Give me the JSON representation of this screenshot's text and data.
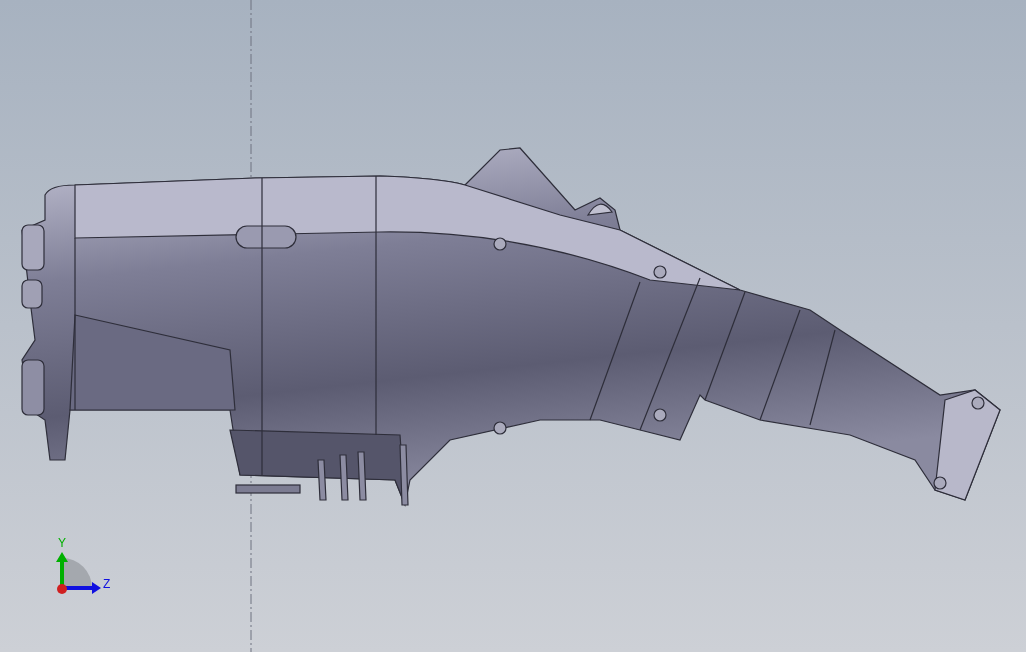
{
  "viewport": {
    "triad": {
      "axes": [
        {
          "label": "Y",
          "kind": "vertical",
          "color": "#00b000"
        },
        {
          "label": "Z",
          "kind": "horizontal",
          "color": "#1010e0"
        }
      ]
    }
  }
}
